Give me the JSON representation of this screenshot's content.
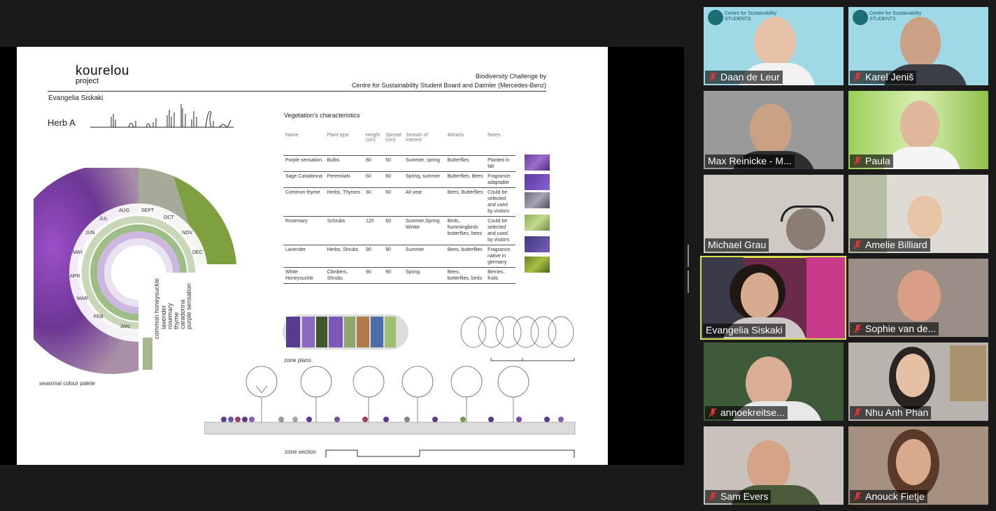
{
  "slide": {
    "logo_main": "kourelou",
    "logo_sub": "project",
    "header_line1": "Biodiversity Challenge by",
    "header_line2": "Centre for Sustainability Student Board and Daimler (Mercedes-Benz)",
    "author": "Evangelia Siskaki",
    "herb_label": "Herb A",
    "table_title": "Vegetation's characteristics",
    "columns": [
      "Name",
      "Plant type",
      "Height (cm)",
      "Spread (cm)",
      "Season of interest",
      "Attracts",
      "Notes"
    ],
    "rows": [
      [
        "Purple sensation",
        "Bulbs",
        "80",
        "50",
        "Summer, spring",
        "Butterflies",
        "Planted in fall"
      ],
      [
        "Sage Caradonna",
        "Perennials",
        "60",
        "60",
        "Spring, summer",
        "Butterflies, Bees",
        "Fragrance, adaptable"
      ],
      [
        "Common thyme",
        "Herbs, Thymes",
        "30",
        "60",
        "All year",
        "Bees, Butterflies",
        "Could be selected and used by visitors"
      ],
      [
        "Rosemary",
        "Schrubs",
        "120",
        "60",
        "Summer,Spring Winter",
        "Birds, hummingbirds butterflies, bees",
        "Could be selected and used by visitors"
      ],
      [
        "Lavender",
        "Herbs, Shrubs",
        "90",
        "90",
        "Summer",
        "Bees, butterflies",
        "Fragrance, native in germany"
      ],
      [
        "White Honeysuckle",
        "Climbers, Shrubs",
        "90",
        "90",
        "Spring",
        "Bees, butterflies, birds",
        "Berries, fruits"
      ]
    ],
    "months": [
      "AUG",
      "SEPT",
      "OCT",
      "NOV",
      "DEC",
      "JUL",
      "JUN",
      "MAY",
      "APR",
      "MAR",
      "FEB",
      "JAN"
    ],
    "plant_names": [
      "common honeysuckle",
      "lavender",
      "rosemary",
      "thyme",
      "caradonna",
      "purple sensation"
    ],
    "palette_label": "seasonal colour palete",
    "zone_plans_label": "zone plans",
    "zone_section_label": "zone section"
  },
  "participants": [
    {
      "name": "Daan de Leur",
      "muted": true,
      "active": false,
      "branded": true
    },
    {
      "name": "Karel Jeniš",
      "muted": true,
      "active": false,
      "branded": true
    },
    {
      "name": "Max Reinicke - M...",
      "muted": false,
      "active": false,
      "branded": false
    },
    {
      "name": "Paula",
      "muted": true,
      "active": false,
      "branded": false
    },
    {
      "name": "Michael Grau",
      "muted": false,
      "active": false,
      "branded": false
    },
    {
      "name": "Amelie Billiard",
      "muted": true,
      "active": false,
      "branded": false
    },
    {
      "name": "Evangelia Siskaki",
      "muted": false,
      "active": true,
      "branded": false
    },
    {
      "name": "Sophie van de...",
      "muted": true,
      "active": false,
      "branded": false
    },
    {
      "name": "annoekreitse...",
      "muted": true,
      "active": false,
      "branded": false
    },
    {
      "name": "Nhu Anh Phan",
      "muted": true,
      "active": false,
      "branded": false
    },
    {
      "name": "Sam Evers",
      "muted": true,
      "active": false,
      "branded": false
    },
    {
      "name": "Anouck Fietje",
      "muted": true,
      "active": false,
      "branded": false
    }
  ],
  "brand": {
    "line1": "Centre for Sustainability",
    "line2": "STUDENTS"
  },
  "colors": {
    "active_speaker": "#d8e04c",
    "muted_icon": "#e0353b",
    "background": "#1a1a1a"
  }
}
